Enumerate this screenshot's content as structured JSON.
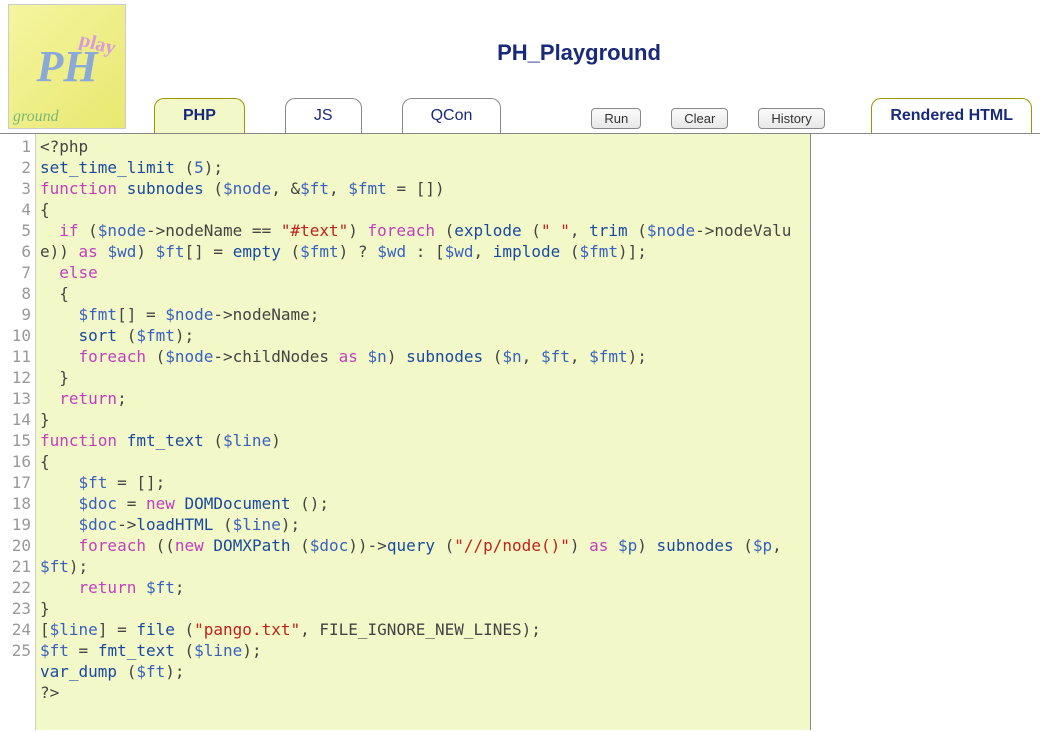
{
  "logo": {
    "ph": "PH",
    "play": "play",
    "ground": "ground"
  },
  "title": "PH_Playground",
  "tabs": {
    "php": "PHP",
    "js": "JS",
    "qcon": "QCon",
    "rendered": "Rendered HTML"
  },
  "buttons": {
    "run": "Run",
    "clear": "Clear",
    "history": "History"
  },
  "code": {
    "lines": [
      [
        [
          "pl",
          "<?php"
        ]
      ],
      [
        [
          "fn",
          "set_time_limit"
        ],
        [
          "pl",
          " ("
        ],
        [
          "num",
          "5"
        ],
        [
          "pl",
          ");"
        ]
      ],
      [
        [
          "kw",
          "function"
        ],
        [
          "pl",
          " "
        ],
        [
          "fn",
          "subnodes"
        ],
        [
          "pl",
          " ("
        ],
        [
          "var",
          "$node"
        ],
        [
          "pl",
          ", &"
        ],
        [
          "var",
          "$ft"
        ],
        [
          "pl",
          ", "
        ],
        [
          "var",
          "$fmt"
        ],
        [
          "pl",
          " = [])"
        ]
      ],
      [
        [
          "pl",
          "{"
        ]
      ],
      [
        [
          "pl",
          "  "
        ],
        [
          "kw",
          "if"
        ],
        [
          "pl",
          " ("
        ],
        [
          "var",
          "$node"
        ],
        [
          "pl",
          "->nodeName == "
        ],
        [
          "str",
          "\"#text\""
        ],
        [
          "pl",
          ") "
        ],
        [
          "kw",
          "foreach"
        ],
        [
          "pl",
          " ("
        ],
        [
          "fn",
          "explode"
        ],
        [
          "pl",
          " ("
        ],
        [
          "str",
          "\" \""
        ],
        [
          "pl",
          ", "
        ],
        [
          "fn",
          "trim"
        ],
        [
          "pl",
          " ("
        ],
        [
          "var",
          "$node"
        ],
        [
          "pl",
          "->nodeValue)) "
        ],
        [
          "kw",
          "as"
        ],
        [
          "pl",
          " "
        ],
        [
          "var",
          "$wd"
        ],
        [
          "pl",
          ") "
        ],
        [
          "var",
          "$ft"
        ],
        [
          "pl",
          "[] = "
        ],
        [
          "fn",
          "empty"
        ],
        [
          "pl",
          " ("
        ],
        [
          "var",
          "$fmt"
        ],
        [
          "pl",
          ") ? "
        ],
        [
          "var",
          "$wd"
        ],
        [
          "pl",
          " : ["
        ],
        [
          "var",
          "$wd"
        ],
        [
          "pl",
          ", "
        ],
        [
          "fn",
          "implode"
        ],
        [
          "pl",
          " ("
        ],
        [
          "var",
          "$fmt"
        ],
        [
          "pl",
          ")];"
        ]
      ],
      [
        [
          "pl",
          "  "
        ],
        [
          "kw",
          "else"
        ]
      ],
      [
        [
          "pl",
          "  {"
        ]
      ],
      [
        [
          "pl",
          "    "
        ],
        [
          "var",
          "$fmt"
        ],
        [
          "pl",
          "[] = "
        ],
        [
          "var",
          "$node"
        ],
        [
          "pl",
          "->nodeName;"
        ]
      ],
      [
        [
          "pl",
          "    "
        ],
        [
          "fn",
          "sort"
        ],
        [
          "pl",
          " ("
        ],
        [
          "var",
          "$fmt"
        ],
        [
          "pl",
          ");"
        ]
      ],
      [
        [
          "pl",
          "    "
        ],
        [
          "kw",
          "foreach"
        ],
        [
          "pl",
          " ("
        ],
        [
          "var",
          "$node"
        ],
        [
          "pl",
          "->childNodes "
        ],
        [
          "kw",
          "as"
        ],
        [
          "pl",
          " "
        ],
        [
          "var",
          "$n"
        ],
        [
          "pl",
          ") "
        ],
        [
          "fn",
          "subnodes"
        ],
        [
          "pl",
          " ("
        ],
        [
          "var",
          "$n"
        ],
        [
          "pl",
          ", "
        ],
        [
          "var",
          "$ft"
        ],
        [
          "pl",
          ", "
        ],
        [
          "var",
          "$fmt"
        ],
        [
          "pl",
          ");"
        ]
      ],
      [
        [
          "pl",
          "  }"
        ]
      ],
      [
        [
          "pl",
          "  "
        ],
        [
          "kw",
          "return"
        ],
        [
          "pl",
          ";"
        ]
      ],
      [
        [
          "pl",
          "}"
        ]
      ],
      [
        [
          "kw",
          "function"
        ],
        [
          "pl",
          " "
        ],
        [
          "fn",
          "fmt_text"
        ],
        [
          "pl",
          " ("
        ],
        [
          "var",
          "$line"
        ],
        [
          "pl",
          ")"
        ]
      ],
      [
        [
          "pl",
          "{"
        ]
      ],
      [
        [
          "pl",
          "    "
        ],
        [
          "var",
          "$ft"
        ],
        [
          "pl",
          " = [];"
        ]
      ],
      [
        [
          "pl",
          "    "
        ],
        [
          "var",
          "$doc"
        ],
        [
          "pl",
          " = "
        ],
        [
          "kw",
          "new"
        ],
        [
          "pl",
          " "
        ],
        [
          "fn",
          "DOMDocument"
        ],
        [
          "pl",
          " ();"
        ]
      ],
      [
        [
          "pl",
          "    "
        ],
        [
          "var",
          "$doc"
        ],
        [
          "pl",
          "->"
        ],
        [
          "fn",
          "loadHTML"
        ],
        [
          "pl",
          " ("
        ],
        [
          "var",
          "$line"
        ],
        [
          "pl",
          ");"
        ]
      ],
      [
        [
          "pl",
          "    "
        ],
        [
          "kw",
          "foreach"
        ],
        [
          "pl",
          " (("
        ],
        [
          "kw",
          "new"
        ],
        [
          "pl",
          " "
        ],
        [
          "fn",
          "DOMXPath"
        ],
        [
          "pl",
          " ("
        ],
        [
          "var",
          "$doc"
        ],
        [
          "pl",
          "))->"
        ],
        [
          "fn",
          "query"
        ],
        [
          "pl",
          " ("
        ],
        [
          "str",
          "\"//p/node()\""
        ],
        [
          "pl",
          ") "
        ],
        [
          "kw",
          "as"
        ],
        [
          "pl",
          " "
        ],
        [
          "var",
          "$p"
        ],
        [
          "pl",
          ") "
        ],
        [
          "fn",
          "subnodes"
        ],
        [
          "pl",
          " ("
        ],
        [
          "var",
          "$p"
        ],
        [
          "pl",
          ", "
        ],
        [
          "var",
          "$ft"
        ],
        [
          "pl",
          ");"
        ]
      ],
      [
        [
          "pl",
          "    "
        ],
        [
          "kw",
          "return"
        ],
        [
          "pl",
          " "
        ],
        [
          "var",
          "$ft"
        ],
        [
          "pl",
          ";"
        ]
      ],
      [
        [
          "pl",
          "}"
        ]
      ],
      [
        [
          "pl",
          "["
        ],
        [
          "var",
          "$line"
        ],
        [
          "pl",
          "] = "
        ],
        [
          "fn",
          "file"
        ],
        [
          "pl",
          " ("
        ],
        [
          "str",
          "\"pango.txt\""
        ],
        [
          "pl",
          ", FILE_IGNORE_NEW_LINES);"
        ]
      ],
      [
        [
          "var",
          "$ft"
        ],
        [
          "pl",
          " = "
        ],
        [
          "fn",
          "fmt_text"
        ],
        [
          "pl",
          " ("
        ],
        [
          "var",
          "$line"
        ],
        [
          "pl",
          ");"
        ]
      ],
      [
        [
          "fn",
          "var_dump"
        ],
        [
          "pl",
          " ("
        ],
        [
          "var",
          "$ft"
        ],
        [
          "pl",
          ");"
        ]
      ],
      [
        [
          "pl",
          "?>"
        ]
      ]
    ]
  }
}
